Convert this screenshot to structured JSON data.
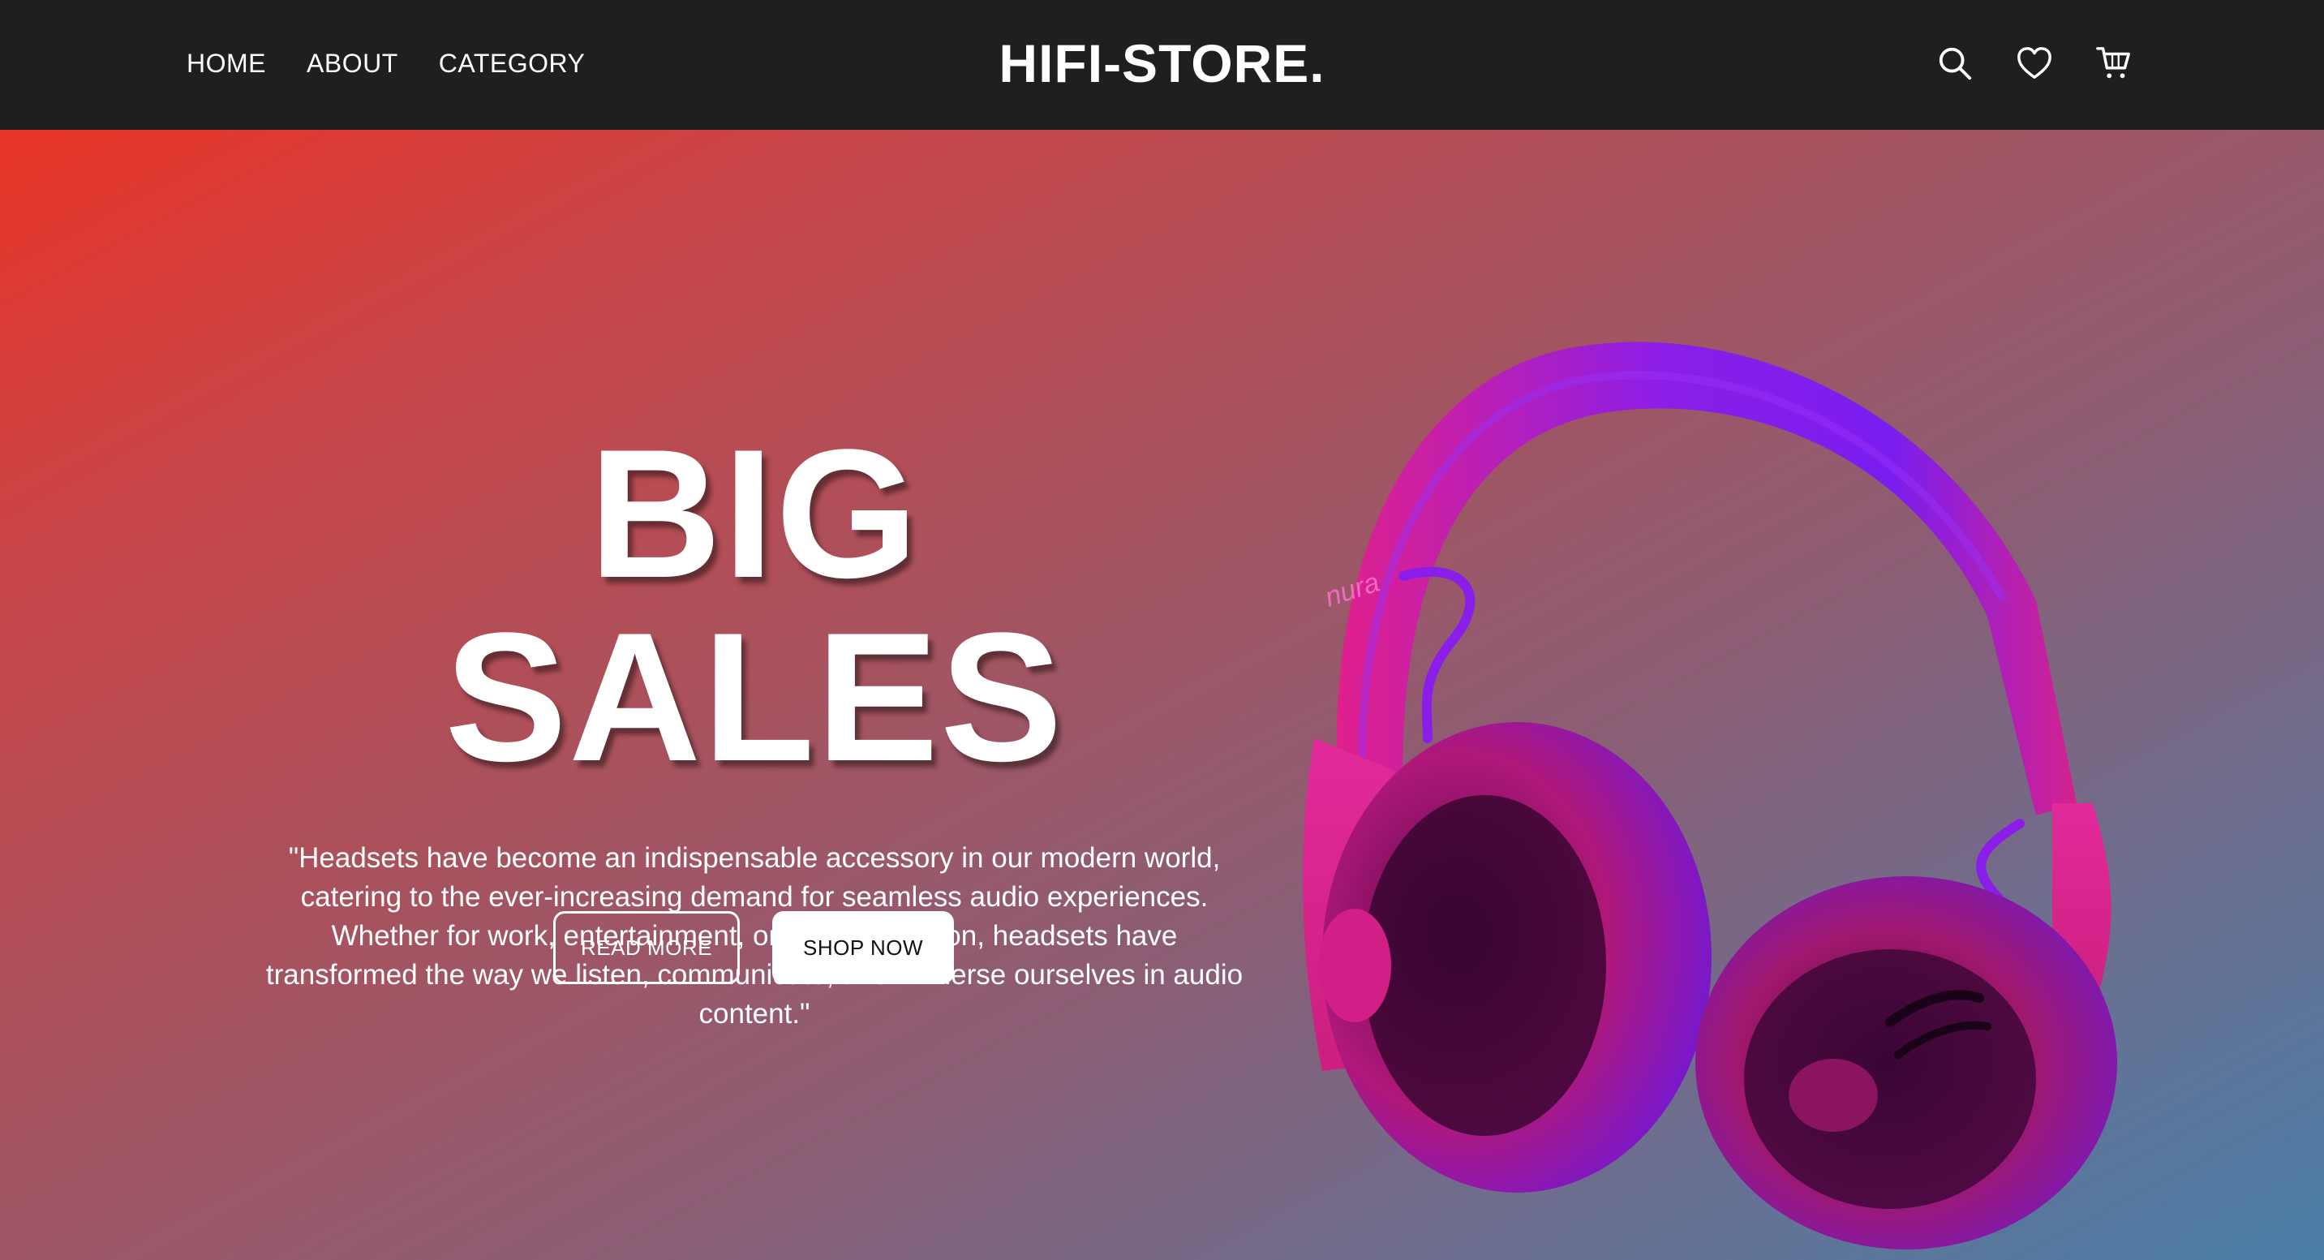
{
  "nav": {
    "links": [
      "HOME",
      "ABOUT",
      "CATEGORY"
    ],
    "brand": "HIFI-STORE.",
    "icons": [
      "search-icon",
      "heart-icon",
      "cart-icon"
    ]
  },
  "hero": {
    "headline": "BIG SALES",
    "blurb": "\"Headsets have become an indispensable accessory in our modern world, catering to the ever-increasing demand for seamless audio experiences. Whether for work, entertainment, or communication, headsets have transformed the way we listen, communicate, and immerse ourselves in audio content.\"",
    "read_more": "READ MORE",
    "shop_now": "SHOP NOW",
    "product_brand": "nura"
  },
  "colors": {
    "topbar": "#1f1f1f",
    "gradient_start": "#e83426",
    "gradient_end": "#4a7ea8",
    "headphone_pink": "#e0208c",
    "headphone_purple": "#7a1df0"
  }
}
